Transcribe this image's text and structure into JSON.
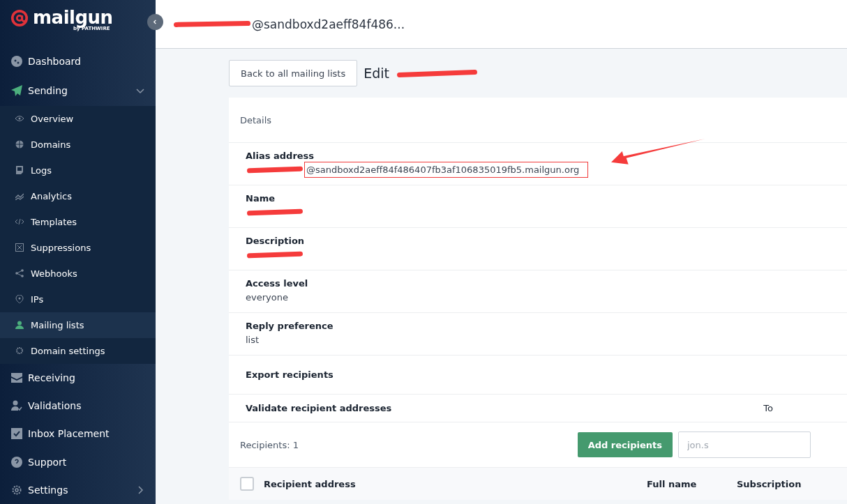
{
  "brand": {
    "name": "mailgun",
    "byline": "by PATHWIRE"
  },
  "sidebar": {
    "items": [
      {
        "label": "Dashboard",
        "selected": false
      },
      {
        "label": "Sending",
        "selected": false,
        "active": true,
        "expanded": true,
        "children": [
          {
            "label": "Overview",
            "selected": false
          },
          {
            "label": "Domains",
            "selected": false
          },
          {
            "label": "Logs",
            "selected": false
          },
          {
            "label": "Analytics",
            "selected": false
          },
          {
            "label": "Templates",
            "selected": false
          },
          {
            "label": "Suppressions",
            "selected": false
          },
          {
            "label": "Webhooks",
            "selected": false
          },
          {
            "label": "IPs",
            "selected": false
          },
          {
            "label": "Mailing lists",
            "selected": true
          },
          {
            "label": "Domain settings",
            "selected": false
          }
        ]
      },
      {
        "label": "Receiving",
        "selected": false
      },
      {
        "label": "Validations",
        "selected": false
      },
      {
        "label": "Inbox Placement",
        "selected": false
      },
      {
        "label": "Support",
        "selected": false
      },
      {
        "label": "Settings",
        "selected": false,
        "expanded": false
      }
    ]
  },
  "header": {
    "title": "@sandboxd2aeff84f486...",
    "redacted": true
  },
  "back_button": "Back to all mailing lists",
  "page_title": {
    "text": "Edit",
    "redacted": true
  },
  "details": {
    "heading": "Details",
    "fields": [
      {
        "label": "Alias address",
        "value": "@sandboxd2aeff84f486407fb3af106835019fb5.mailgun.org",
        "redacted": true,
        "highlighted": true
      },
      {
        "label": "Name",
        "redacted": true
      },
      {
        "label": "Description",
        "redacted": true
      },
      {
        "label": "Access level",
        "value": "everyone"
      },
      {
        "label": "Reply preference",
        "value": "list"
      }
    ],
    "actions": [
      {
        "label": "Export recipients"
      },
      {
        "label": "Validate recipient addresses",
        "note": "To"
      }
    ]
  },
  "annotation_arrow": true,
  "recipients": {
    "count": "Recipients: 1",
    "add_button": "Add recipients",
    "search": {
      "placeholder": "jon.s"
    },
    "columns": [
      {
        "label": "Recipient address"
      },
      {
        "label": "Full name"
      },
      {
        "label": "Subscription"
      }
    ],
    "select_all": {
      "checked": false
    }
  }
}
